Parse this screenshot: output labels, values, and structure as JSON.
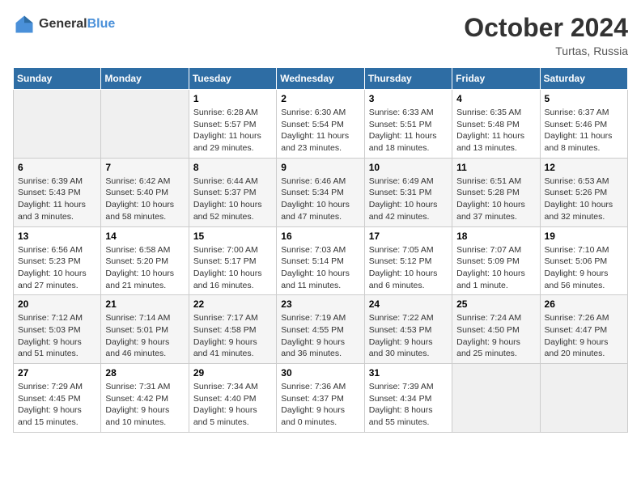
{
  "header": {
    "logo_line1": "General",
    "logo_line2": "Blue",
    "month": "October 2024",
    "location": "Turtas, Russia"
  },
  "weekdays": [
    "Sunday",
    "Monday",
    "Tuesday",
    "Wednesday",
    "Thursday",
    "Friday",
    "Saturday"
  ],
  "weeks": [
    [
      {
        "day": "",
        "info": ""
      },
      {
        "day": "",
        "info": ""
      },
      {
        "day": "1",
        "info": "Sunrise: 6:28 AM\nSunset: 5:57 PM\nDaylight: 11 hours and 29 minutes."
      },
      {
        "day": "2",
        "info": "Sunrise: 6:30 AM\nSunset: 5:54 PM\nDaylight: 11 hours and 23 minutes."
      },
      {
        "day": "3",
        "info": "Sunrise: 6:33 AM\nSunset: 5:51 PM\nDaylight: 11 hours and 18 minutes."
      },
      {
        "day": "4",
        "info": "Sunrise: 6:35 AM\nSunset: 5:48 PM\nDaylight: 11 hours and 13 minutes."
      },
      {
        "day": "5",
        "info": "Sunrise: 6:37 AM\nSunset: 5:46 PM\nDaylight: 11 hours and 8 minutes."
      }
    ],
    [
      {
        "day": "6",
        "info": "Sunrise: 6:39 AM\nSunset: 5:43 PM\nDaylight: 11 hours and 3 minutes."
      },
      {
        "day": "7",
        "info": "Sunrise: 6:42 AM\nSunset: 5:40 PM\nDaylight: 10 hours and 58 minutes."
      },
      {
        "day": "8",
        "info": "Sunrise: 6:44 AM\nSunset: 5:37 PM\nDaylight: 10 hours and 52 minutes."
      },
      {
        "day": "9",
        "info": "Sunrise: 6:46 AM\nSunset: 5:34 PM\nDaylight: 10 hours and 47 minutes."
      },
      {
        "day": "10",
        "info": "Sunrise: 6:49 AM\nSunset: 5:31 PM\nDaylight: 10 hours and 42 minutes."
      },
      {
        "day": "11",
        "info": "Sunrise: 6:51 AM\nSunset: 5:28 PM\nDaylight: 10 hours and 37 minutes."
      },
      {
        "day": "12",
        "info": "Sunrise: 6:53 AM\nSunset: 5:26 PM\nDaylight: 10 hours and 32 minutes."
      }
    ],
    [
      {
        "day": "13",
        "info": "Sunrise: 6:56 AM\nSunset: 5:23 PM\nDaylight: 10 hours and 27 minutes."
      },
      {
        "day": "14",
        "info": "Sunrise: 6:58 AM\nSunset: 5:20 PM\nDaylight: 10 hours and 21 minutes."
      },
      {
        "day": "15",
        "info": "Sunrise: 7:00 AM\nSunset: 5:17 PM\nDaylight: 10 hours and 16 minutes."
      },
      {
        "day": "16",
        "info": "Sunrise: 7:03 AM\nSunset: 5:14 PM\nDaylight: 10 hours and 11 minutes."
      },
      {
        "day": "17",
        "info": "Sunrise: 7:05 AM\nSunset: 5:12 PM\nDaylight: 10 hours and 6 minutes."
      },
      {
        "day": "18",
        "info": "Sunrise: 7:07 AM\nSunset: 5:09 PM\nDaylight: 10 hours and 1 minute."
      },
      {
        "day": "19",
        "info": "Sunrise: 7:10 AM\nSunset: 5:06 PM\nDaylight: 9 hours and 56 minutes."
      }
    ],
    [
      {
        "day": "20",
        "info": "Sunrise: 7:12 AM\nSunset: 5:03 PM\nDaylight: 9 hours and 51 minutes."
      },
      {
        "day": "21",
        "info": "Sunrise: 7:14 AM\nSunset: 5:01 PM\nDaylight: 9 hours and 46 minutes."
      },
      {
        "day": "22",
        "info": "Sunrise: 7:17 AM\nSunset: 4:58 PM\nDaylight: 9 hours and 41 minutes."
      },
      {
        "day": "23",
        "info": "Sunrise: 7:19 AM\nSunset: 4:55 PM\nDaylight: 9 hours and 36 minutes."
      },
      {
        "day": "24",
        "info": "Sunrise: 7:22 AM\nSunset: 4:53 PM\nDaylight: 9 hours and 30 minutes."
      },
      {
        "day": "25",
        "info": "Sunrise: 7:24 AM\nSunset: 4:50 PM\nDaylight: 9 hours and 25 minutes."
      },
      {
        "day": "26",
        "info": "Sunrise: 7:26 AM\nSunset: 4:47 PM\nDaylight: 9 hours and 20 minutes."
      }
    ],
    [
      {
        "day": "27",
        "info": "Sunrise: 7:29 AM\nSunset: 4:45 PM\nDaylight: 9 hours and 15 minutes."
      },
      {
        "day": "28",
        "info": "Sunrise: 7:31 AM\nSunset: 4:42 PM\nDaylight: 9 hours and 10 minutes."
      },
      {
        "day": "29",
        "info": "Sunrise: 7:34 AM\nSunset: 4:40 PM\nDaylight: 9 hours and 5 minutes."
      },
      {
        "day": "30",
        "info": "Sunrise: 7:36 AM\nSunset: 4:37 PM\nDaylight: 9 hours and 0 minutes."
      },
      {
        "day": "31",
        "info": "Sunrise: 7:39 AM\nSunset: 4:34 PM\nDaylight: 8 hours and 55 minutes."
      },
      {
        "day": "",
        "info": ""
      },
      {
        "day": "",
        "info": ""
      }
    ]
  ]
}
